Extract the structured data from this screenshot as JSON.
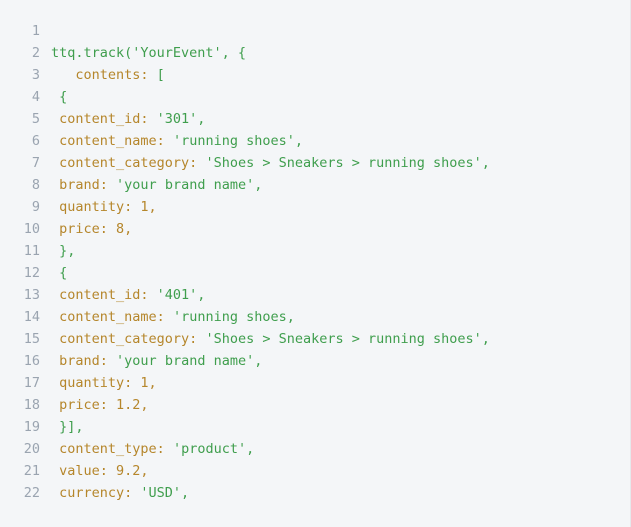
{
  "editor": {
    "language": "javascript",
    "background_color": "#f4f6f8",
    "gutter_color": "#9aa4b0",
    "string_color": "#3f9e4d",
    "key_color": "#b5862b",
    "first_line_number": 1,
    "last_line_number": 22
  },
  "code": {
    "lines": [
      {
        "number": "1",
        "tokens": []
      },
      {
        "number": "2",
        "tokens": [
          {
            "text": "ttq.track('YourEvent', {",
            "type": "call"
          }
        ]
      },
      {
        "number": "3",
        "tokens": [
          {
            "text": "   contents",
            "type": "key"
          },
          {
            "text": ": ",
            "type": "key"
          },
          {
            "text": "[",
            "type": "punct"
          }
        ]
      },
      {
        "number": "4",
        "tokens": [
          {
            "text": " {",
            "type": "punct"
          }
        ]
      },
      {
        "number": "5",
        "tokens": [
          {
            "text": " content_id",
            "type": "key"
          },
          {
            "text": ": ",
            "type": "key"
          },
          {
            "text": "'301',",
            "type": "string"
          }
        ]
      },
      {
        "number": "6",
        "tokens": [
          {
            "text": " content_name",
            "type": "key"
          },
          {
            "text": ": ",
            "type": "key"
          },
          {
            "text": "'running shoes',",
            "type": "string"
          }
        ]
      },
      {
        "number": "7",
        "tokens": [
          {
            "text": " content_category",
            "type": "key"
          },
          {
            "text": ": ",
            "type": "key"
          },
          {
            "text": "'Shoes > Sneakers > running shoes',",
            "type": "string"
          }
        ]
      },
      {
        "number": "8",
        "tokens": [
          {
            "text": " brand",
            "type": "key"
          },
          {
            "text": ": ",
            "type": "key"
          },
          {
            "text": "'your brand name',",
            "type": "string"
          }
        ]
      },
      {
        "number": "9",
        "tokens": [
          {
            "text": " quantity",
            "type": "key"
          },
          {
            "text": ": ",
            "type": "key"
          },
          {
            "text": "1,",
            "type": "num"
          }
        ]
      },
      {
        "number": "10",
        "tokens": [
          {
            "text": " price",
            "type": "key"
          },
          {
            "text": ": ",
            "type": "key"
          },
          {
            "text": "8,",
            "type": "num"
          }
        ]
      },
      {
        "number": "11",
        "tokens": [
          {
            "text": " },",
            "type": "punct"
          }
        ]
      },
      {
        "number": "12",
        "tokens": [
          {
            "text": " {",
            "type": "punct"
          }
        ]
      },
      {
        "number": "13",
        "tokens": [
          {
            "text": " content_id",
            "type": "key"
          },
          {
            "text": ": ",
            "type": "key"
          },
          {
            "text": "'401',",
            "type": "string"
          }
        ]
      },
      {
        "number": "14",
        "tokens": [
          {
            "text": " content_name",
            "type": "key"
          },
          {
            "text": ": ",
            "type": "key"
          },
          {
            "text": "'running shoes,",
            "type": "string"
          }
        ]
      },
      {
        "number": "15",
        "tokens": [
          {
            "text": " content_category",
            "type": "key"
          },
          {
            "text": ": ",
            "type": "key"
          },
          {
            "text": "'Shoes > Sneakers > running shoes',",
            "type": "string"
          }
        ]
      },
      {
        "number": "16",
        "tokens": [
          {
            "text": " brand",
            "type": "key"
          },
          {
            "text": ": ",
            "type": "key"
          },
          {
            "text": "'your brand name',",
            "type": "string"
          }
        ]
      },
      {
        "number": "17",
        "tokens": [
          {
            "text": " quantity",
            "type": "key"
          },
          {
            "text": ": ",
            "type": "key"
          },
          {
            "text": "1,",
            "type": "num"
          }
        ]
      },
      {
        "number": "18",
        "tokens": [
          {
            "text": " price",
            "type": "key"
          },
          {
            "text": ": ",
            "type": "key"
          },
          {
            "text": "1.2,",
            "type": "num"
          }
        ]
      },
      {
        "number": "19",
        "tokens": [
          {
            "text": " }],",
            "type": "punct"
          }
        ]
      },
      {
        "number": "20",
        "tokens": [
          {
            "text": " content_type",
            "type": "key"
          },
          {
            "text": ": ",
            "type": "key"
          },
          {
            "text": "'product',",
            "type": "string"
          }
        ]
      },
      {
        "number": "21",
        "tokens": [
          {
            "text": " value",
            "type": "key"
          },
          {
            "text": ": ",
            "type": "key"
          },
          {
            "text": "9.2,",
            "type": "num"
          }
        ]
      },
      {
        "number": "22",
        "tokens": [
          {
            "text": " currency",
            "type": "key"
          },
          {
            "text": ": ",
            "type": "key"
          },
          {
            "text": "'USD',",
            "type": "string"
          }
        ]
      }
    ]
  }
}
